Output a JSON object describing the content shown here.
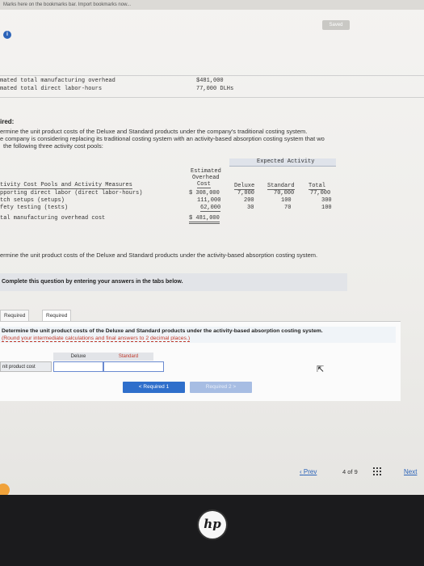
{
  "browser": {
    "bookmarks_bar_text": "Marks here on the bookmarks bar.",
    "import_bookmarks_link": "Import bookmarks now..."
  },
  "header": {
    "saved_label": "Saved",
    "info_icon": "info-icon"
  },
  "given": {
    "overhead_label": "mated total manufacturing overhead",
    "overhead_value": "$481,000",
    "labor_label": "mated total direct labor-hours",
    "labor_value": "77,000 DLHs"
  },
  "required": {
    "heading": "ired:",
    "line1": "ermine the unit product costs of the Deluxe and Standard products under the company's traditional costing system.",
    "line2": "e company is considering replacing its traditional costing system with an activity-based absorption costing system that wo",
    "line3": "the following three activity cost pools:"
  },
  "activity_table": {
    "col_header_overhead": [
      "Estimated",
      "Overhead",
      "Cost"
    ],
    "expected_activity_label": "Expected Activity",
    "col_deluxe": "Deluxe",
    "col_standard": "Standard",
    "col_total": "Total",
    "pools_header": "tivity Cost Pools and Activity Measures",
    "rows": [
      {
        "label": "pporting direct labor (direct labor-hours)",
        "cost": "$ 308,000",
        "deluxe": "7,000",
        "standard": "70,000",
        "total": "77,000"
      },
      {
        "label": "tch setups (setups)",
        "cost": "111,000",
        "deluxe": "200",
        "standard": "100",
        "total": "300"
      },
      {
        "label": "fety testing (tests)",
        "cost": "62,000",
        "deluxe": "30",
        "standard": "70",
        "total": "100"
      }
    ],
    "total_label": "tal manufacturing overhead cost",
    "total_value": "$ 481,000"
  },
  "question": "ermine the unit product costs of the Deluxe and Standard products under the activity-based absorption costing system.",
  "instructions": "Complete this question by entering your answers in the tabs below.",
  "tabs": [
    {
      "label": "Required 1"
    },
    {
      "label": "Required 2"
    }
  ],
  "panel": {
    "prompt": "Determine the unit product costs of the Deluxe and Standard products under the activity-based absorption costing system.",
    "note": "(Round your intermediate calculations and final answers to 2 decimal places.)",
    "col_deluxe": "Deluxe",
    "col_standard": "Standard",
    "row_label": "nit product cost",
    "deluxe_value": "",
    "standard_value": ""
  },
  "buttons": {
    "prev_required": "< Required 1",
    "next_required": "Required 2 >"
  },
  "footer": {
    "prev": "Prev",
    "page_current": "4",
    "page_of": "of",
    "page_total": "9",
    "next": "Next"
  },
  "device": {
    "logo": "hp"
  }
}
